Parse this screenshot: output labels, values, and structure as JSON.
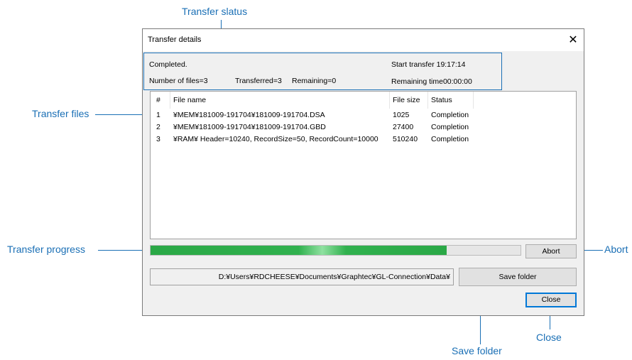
{
  "callouts": {
    "transfer_status": "Transfer slatus",
    "transfer_files": "Transfer files",
    "transfer_progress": "Transfer progress",
    "abort": "Abort",
    "save_folder": "Save folder",
    "close": "Close"
  },
  "dialog": {
    "title": "Transfer details",
    "close_glyph": "✕",
    "status": {
      "state": "Completed.",
      "start_transfer": "Start transfer 19:17:14",
      "number_of_files": "Number of files=3",
      "transferred": "Transferred=3",
      "remaining": "Remaining=0",
      "remaining_time": "Remaining time00:00:00"
    },
    "file_list": {
      "columns": [
        "#",
        "File name",
        "File size",
        "Status"
      ],
      "rows": [
        {
          "num": "1",
          "name": "¥MEM¥181009-191704¥181009-191704.DSA",
          "size": "1025",
          "status": "Completion"
        },
        {
          "num": "2",
          "name": "¥MEM¥181009-191704¥181009-191704.GBD",
          "size": "27400",
          "status": "Completion"
        },
        {
          "num": "3",
          "name": "¥RAM¥ Header=10240, RecordSize=50, RecordCount=10000",
          "size": "510240",
          "status": "Completion"
        }
      ]
    },
    "progress": {
      "fraction": 0.8
    },
    "abort_label": "Abort",
    "path": "D:¥Users¥RDCHEESE¥Documents¥Graphtec¥GL-Connection¥Data¥",
    "save_folder_label": "Save folder",
    "close_label": "Close"
  },
  "colors": {
    "accent": "#1a6fb5",
    "progress_green": "#2aa846"
  }
}
